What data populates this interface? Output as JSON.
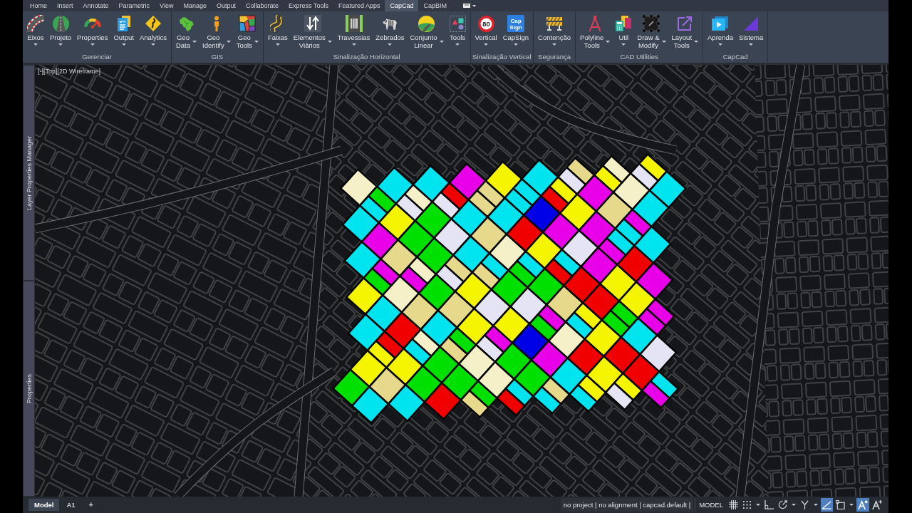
{
  "ribbon_tabs": [
    {
      "label": "Home",
      "selected": false
    },
    {
      "label": "Insert",
      "selected": false
    },
    {
      "label": "Annotate",
      "selected": false
    },
    {
      "label": "Parametric",
      "selected": false
    },
    {
      "label": "View",
      "selected": false
    },
    {
      "label": "Manage",
      "selected": false
    },
    {
      "label": "Output",
      "selected": false
    },
    {
      "label": "Collaborate",
      "selected": false
    },
    {
      "label": "Express Tools",
      "selected": false
    },
    {
      "label": "Featured Apps",
      "selected": false
    },
    {
      "label": "CapCad",
      "selected": true
    },
    {
      "label": "CapBIM",
      "selected": false
    }
  ],
  "ribbon_panels": [
    {
      "title": "Gerenciar",
      "buttons": [
        {
          "label": "Eixos",
          "kind": "below"
        },
        {
          "label": "Projeto",
          "kind": "below"
        },
        {
          "label": "Properties",
          "kind": "below"
        },
        {
          "label": "Output",
          "kind": "below"
        },
        {
          "label": "Analytics",
          "kind": "below"
        }
      ]
    },
    {
      "title": "GIS",
      "buttons": [
        {
          "label": "Geo\nData",
          "kind": "beside"
        },
        {
          "label": "Geo\nIdentify",
          "kind": "beside"
        },
        {
          "label": "Geo\nTools",
          "kind": "beside"
        }
      ]
    },
    {
      "title": "Sinalização Horizontal",
      "buttons": [
        {
          "label": "Faixas",
          "kind": "below"
        },
        {
          "label": "Elementos\nViários",
          "kind": "beside"
        },
        {
          "label": "Travessias",
          "kind": "below"
        },
        {
          "label": "Zebrados",
          "kind": "below"
        },
        {
          "label": "Conjunto\nLinear",
          "kind": "beside"
        },
        {
          "label": "Tools",
          "kind": "below"
        }
      ]
    },
    {
      "title": "Sinalização Vertical",
      "buttons": [
        {
          "label": "Vertical",
          "kind": "below",
          "icon_text": "80"
        },
        {
          "label": "CapSign",
          "kind": "below",
          "icon_text": "Cap\nSign"
        }
      ]
    },
    {
      "title": "Segurança",
      "buttons": [
        {
          "label": "Contenção",
          "kind": "below"
        }
      ]
    },
    {
      "title": "CAD Utilities",
      "buttons": [
        {
          "label": "Polyline\nTools",
          "kind": "beside"
        },
        {
          "label": "Util",
          "kind": "below"
        },
        {
          "label": "Draw &\nModify",
          "kind": "beside"
        },
        {
          "label": "Layout\nTools",
          "kind": "beside"
        }
      ]
    },
    {
      "title": "CapCad",
      "buttons": [
        {
          "label": "Aprenda",
          "kind": "below"
        },
        {
          "label": "Sistema",
          "kind": "below"
        }
      ]
    }
  ],
  "side_palettes": [
    {
      "label": "Layer Properties Manager"
    },
    {
      "label": "Properties"
    }
  ],
  "viewport": {
    "label": "[-][Top][2D Wireframe]"
  },
  "layout_tabs": [
    {
      "label": "Model",
      "selected": true
    },
    {
      "label": "A1",
      "selected": false
    }
  ],
  "new_layout_button": "+",
  "status_bar": {
    "info": "no project | no alignment | capcad.default |",
    "space_button": "MODEL",
    "tools": [
      {
        "kind": "grid",
        "on": false,
        "caret": false
      },
      {
        "kind": "snap",
        "on": false,
        "caret": true
      },
      {
        "kind": "ortho",
        "on": false,
        "caret": false
      },
      {
        "kind": "polar",
        "on": false,
        "caret": true
      },
      {
        "kind": "isodraft",
        "on": false,
        "caret": true
      },
      {
        "kind": "tracking",
        "on": true,
        "caret": false
      },
      {
        "kind": "osnap",
        "on": false,
        "caret": true
      },
      {
        "kind": "visibility",
        "on": true,
        "caret": false
      },
      {
        "kind": "scale",
        "on": false,
        "caret": false
      }
    ]
  }
}
